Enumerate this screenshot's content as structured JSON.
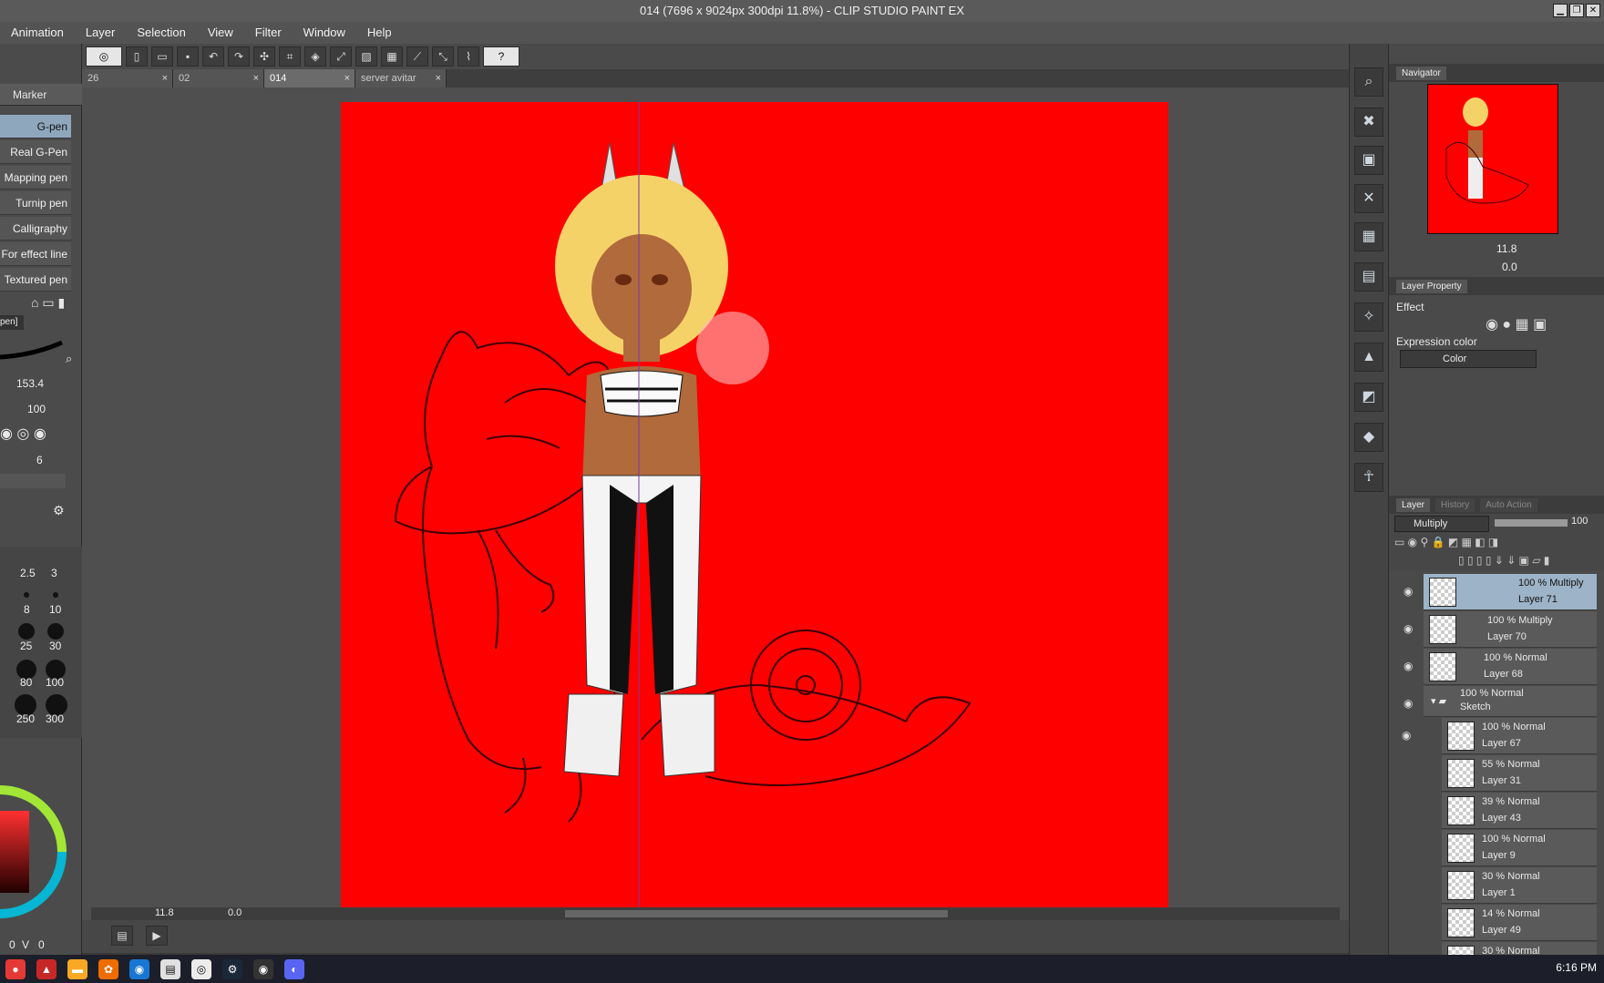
{
  "window": {
    "title": "014 (7696 x 9024px 300dpi 11.8%)  - CLIP STUDIO PAINT EX",
    "min_label": "▁",
    "max_label": "❐",
    "close_label": "✕"
  },
  "menu": [
    "Animation",
    "Layer",
    "Selection",
    "View",
    "Filter",
    "Window",
    "Help"
  ],
  "help_icon": "?",
  "tabs": [
    {
      "label": "26"
    },
    {
      "label": "02"
    },
    {
      "label": "014"
    },
    {
      "label": "server avitar"
    }
  ],
  "tab_close_glyph": "×",
  "subtool": {
    "group": "Marker",
    "items": [
      "G-pen",
      "Real G-Pen",
      "Mapping pen",
      "Turnip pen",
      "Calligraphy",
      "For effect line",
      "Textured pen"
    ],
    "selected": "G-pen",
    "detail_label": "pen]"
  },
  "brush": {
    "size": "153.4",
    "opacity": "100",
    "stabilization": "6",
    "size_presets": [
      "2.5",
      "3",
      "8",
      "10",
      "25",
      "30",
      "80",
      "100",
      "250",
      "300"
    ]
  },
  "color_values": {
    "a": "0",
    "v": "V",
    "b": "0"
  },
  "canvas": {
    "background_color": "#ff0000",
    "zoom": "11.8",
    "rotation": "0.0"
  },
  "navigator": {
    "tab": "Navigator",
    "zoom": "11.8",
    "rotation": "0.0"
  },
  "layer_property": {
    "tab": "Layer Property",
    "effect_label": "Effect",
    "expression_color_label": "Expression color",
    "expression_color_value": "Color"
  },
  "layer_panel": {
    "tabs": [
      "Layer",
      "History",
      "Auto Action"
    ],
    "blend_mode": "Multiply",
    "opacity": "100",
    "layers": [
      {
        "mode": "100 % Multiply",
        "name": "Layer 71",
        "selected": true
      },
      {
        "mode": "100 % Multiply",
        "name": "Layer 70",
        "selected": false
      },
      {
        "mode": "100 % Normal",
        "name": "Layer 68",
        "selected": false
      },
      {
        "mode": "100 % Normal",
        "name": "Sketch",
        "selected": false,
        "folder": true
      },
      {
        "mode": "100 % Normal",
        "name": "Layer 67",
        "selected": false
      },
      {
        "mode": "55 % Normal",
        "name": "Layer 31",
        "selected": false
      },
      {
        "mode": "39 % Normal",
        "name": "Layer 43",
        "selected": false
      },
      {
        "mode": "100 % Normal",
        "name": "Layer 9",
        "selected": false
      },
      {
        "mode": "30 % Normal",
        "name": "Layer 1",
        "selected": false
      },
      {
        "mode": "14 % Normal",
        "name": "Layer 49",
        "selected": false
      },
      {
        "mode": "30 % Normal",
        "name": "",
        "selected": false
      }
    ]
  },
  "taskbar": {
    "icons": [
      "chrome-icon",
      "pdf-icon",
      "explorer-icon",
      "paint-icon",
      "edge-icon",
      "clipstudio-icon",
      "steam-icon",
      "steam-alt-icon",
      "obs-icon",
      "discord-icon"
    ],
    "time": "6:16 PM"
  }
}
